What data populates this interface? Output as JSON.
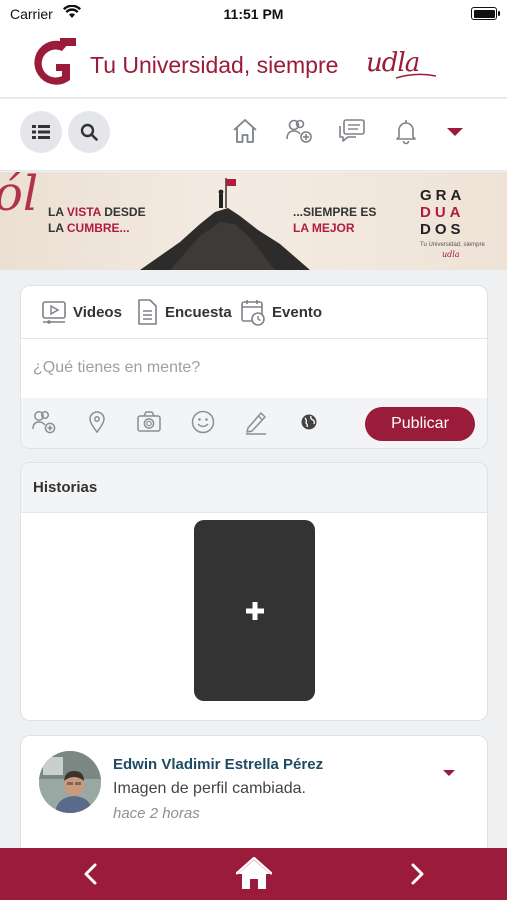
{
  "status_bar": {
    "carrier": "Carrier",
    "time": "11:51 PM"
  },
  "brand": {
    "tagline": "Tu Universidad, siempre",
    "logo_text": "udla",
    "accent_color": "#9a1b3a"
  },
  "nav": {
    "icons": [
      "list-icon",
      "search-icon",
      "home-icon",
      "friends-icon",
      "messages-icon",
      "bell-icon",
      "caret-down-icon"
    ]
  },
  "banner": {
    "left_line1_a": "LA ",
    "left_line1_b": "VISTA",
    "left_line1_c": " DESDE",
    "left_line2_a": "LA ",
    "left_line2_b": "CUMBRE...",
    "right_line1": "...SIEMPRE ES",
    "right_line2": "LA MEJOR",
    "grad_line1": "GRA",
    "grad_line2": "DUA",
    "grad_line3": "DOS",
    "grad_sub": "Tu Universidad, siempre",
    "grad_logo": "udla"
  },
  "composer": {
    "tabs": [
      {
        "label": "Videos",
        "icon": "video-icon"
      },
      {
        "label": "Encuesta",
        "icon": "poll-icon"
      },
      {
        "label": "Evento",
        "icon": "calendar-icon"
      }
    ],
    "placeholder": "¿Qué tienes en mente?",
    "tools": [
      "tag-friends-icon",
      "location-icon",
      "camera-icon",
      "emoji-icon",
      "pencil-icon",
      "globe-icon"
    ],
    "publish_label": "Publicar"
  },
  "stories": {
    "title": "Historias"
  },
  "post": {
    "author": "Edwin Vladimir Estrella Pérez",
    "text": "Imagen de perfil cambiada.",
    "time": "hace 2 horas"
  },
  "bottom_bar": {
    "icons": [
      "back-icon",
      "home-icon",
      "forward-icon"
    ]
  }
}
